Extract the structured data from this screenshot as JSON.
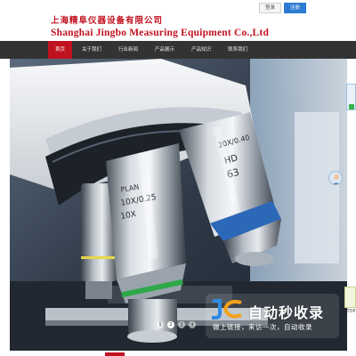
{
  "header": {
    "company_cn": "上海精阜仪器设备有限公司",
    "company_en": "Shanghai Jingbo Measuring Equipment Co.,Ltd"
  },
  "top_links": {
    "login": "登录",
    "register": "注册"
  },
  "nav": {
    "items": [
      {
        "label": "首页",
        "active": true
      },
      {
        "label": "关于我们",
        "active": false
      },
      {
        "label": "行业新闻",
        "active": false
      },
      {
        "label": "产品展示",
        "active": false
      },
      {
        "label": "产品知识",
        "active": false
      },
      {
        "label": "联系我们",
        "active": false
      }
    ]
  },
  "hero": {
    "objective_labels": [
      "PLAN",
      "10X/0.25",
      "10X",
      "20X/0.40",
      "HD",
      "63"
    ],
    "dots": [
      "1",
      "2",
      "3",
      "4"
    ],
    "active_dot": 1
  },
  "watermark": {
    "title": "自动秒收录",
    "subtitle": "做上链接，来访一次，自动收录"
  },
  "side": {
    "top": "TOP"
  },
  "colors": {
    "brand_red": "#c1121f",
    "nav_bg": "#333333",
    "link_blue": "#2d7bd1"
  },
  "icons": [
    "customer-service-icon",
    "wechat-icon",
    "watermark-logo-icon"
  ]
}
